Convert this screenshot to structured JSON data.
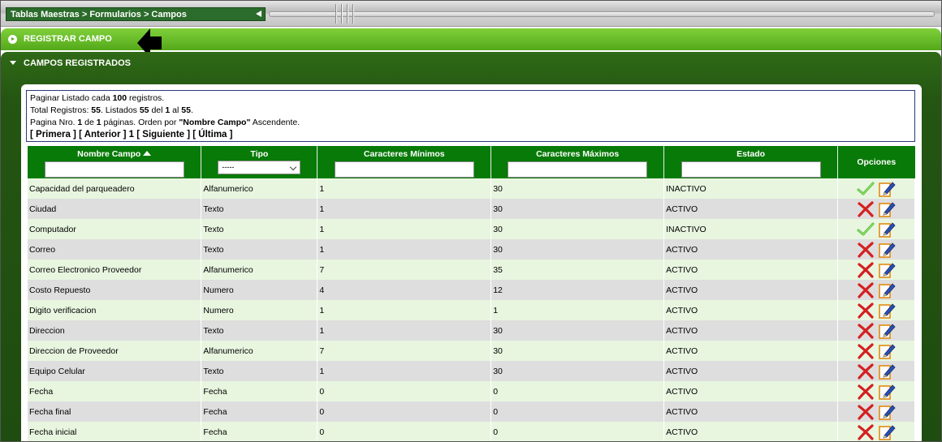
{
  "breadcrumb": "Tablas Maestras > Formularios > Campos",
  "sections": {
    "register": "REGISTRAR CAMPO",
    "registered": "CAMPOS REGISTRADOS"
  },
  "info": {
    "line1_prefix": "Paginar Listado cada ",
    "line1_value": "100",
    "line1_suffix": " registros.",
    "line2_prefix": "Total Registros: ",
    "total": "55",
    "line2_mid1": ". Listados ",
    "listed": "55",
    "line2_mid2": " del ",
    "from": "1",
    "line2_mid3": " al ",
    "to": "55",
    "line2_suffix": ".",
    "line3_prefix": "Pagina Nro. ",
    "page": "1",
    "line3_mid1": " de ",
    "pages": "1",
    "line3_mid2": " páginas. Orden por ",
    "order_field": "\"Nombre Campo\"",
    "line3_suffix": " Ascendente."
  },
  "pager": {
    "first": "[ Primera ]",
    "prev": "[ Anterior ]",
    "current": "1",
    "next": "[ Siguiente ]",
    "last": "[ Última ]"
  },
  "table": {
    "headers": {
      "nombre": "Nombre Campo",
      "tipo": "Tipo",
      "min": "Caracteres Mínimos",
      "max": "Caracteres Máximos",
      "estado": "Estado",
      "opciones": "Opciones"
    },
    "tipo_select_value": "-----",
    "rows": [
      {
        "nombre": "Capacidad del parqueadero",
        "tipo": "Alfanumerico",
        "min": "1",
        "max": "30",
        "estado": "INACTIVO",
        "action": "activate"
      },
      {
        "nombre": "Ciudad",
        "tipo": "Texto",
        "min": "1",
        "max": "30",
        "estado": "ACTIVO",
        "action": "deactivate"
      },
      {
        "nombre": "Computador",
        "tipo": "Texto",
        "min": "1",
        "max": "30",
        "estado": "INACTIVO",
        "action": "activate"
      },
      {
        "nombre": "Correo",
        "tipo": "Texto",
        "min": "1",
        "max": "30",
        "estado": "ACTIVO",
        "action": "deactivate"
      },
      {
        "nombre": "Correo Electronico Proveedor",
        "tipo": "Alfanumerico",
        "min": "7",
        "max": "35",
        "estado": "ACTIVO",
        "action": "deactivate"
      },
      {
        "nombre": "Costo Repuesto",
        "tipo": "Numero",
        "min": "4",
        "max": "12",
        "estado": "ACTIVO",
        "action": "deactivate"
      },
      {
        "nombre": "Digito verificacion",
        "tipo": "Numero",
        "min": "1",
        "max": "1",
        "estado": "ACTIVO",
        "action": "deactivate"
      },
      {
        "nombre": "Direccion",
        "tipo": "Texto",
        "min": "1",
        "max": "30",
        "estado": "ACTIVO",
        "action": "deactivate"
      },
      {
        "nombre": "Direccion de Proveedor",
        "tipo": "Alfanumerico",
        "min": "7",
        "max": "30",
        "estado": "ACTIVO",
        "action": "deactivate"
      },
      {
        "nombre": "Equipo Celular",
        "tipo": "Texto",
        "min": "1",
        "max": "30",
        "estado": "ACTIVO",
        "action": "deactivate"
      },
      {
        "nombre": "Fecha",
        "tipo": "Fecha",
        "min": "0",
        "max": "0",
        "estado": "ACTIVO",
        "action": "deactivate"
      },
      {
        "nombre": "Fecha final",
        "tipo": "Fecha",
        "min": "0",
        "max": "0",
        "estado": "ACTIVO",
        "action": "deactivate"
      },
      {
        "nombre": "Fecha inicial",
        "tipo": "Fecha",
        "min": "0",
        "max": "0",
        "estado": "ACTIVO",
        "action": "deactivate"
      }
    ]
  },
  "icons": {
    "activate": "check-icon",
    "deactivate": "delete-x-icon",
    "edit": "edit-icon"
  },
  "colors": {
    "header_green": "#087a08",
    "section_green": "#54a91a",
    "row_odd": "#e8f6e0",
    "row_even": "#dedede"
  }
}
